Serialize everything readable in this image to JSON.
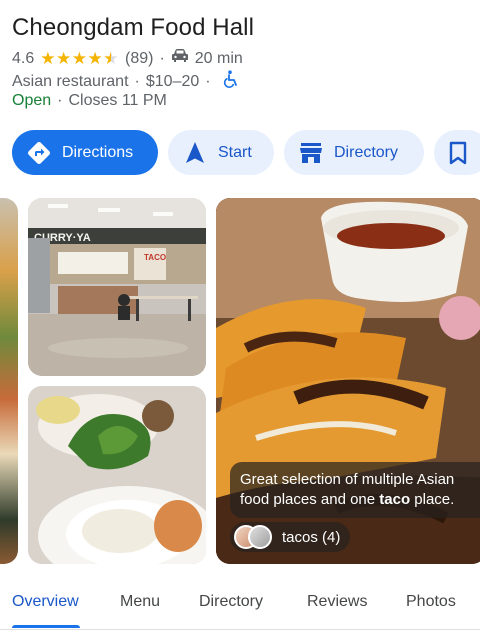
{
  "place": {
    "name": "Cheongdam Food Hall",
    "rating": "4.6",
    "rating_value": 4.6,
    "review_count": "(89)",
    "drive_time": "20 min",
    "category": "Asian restaurant",
    "price": "$10–20",
    "status": "Open",
    "hours": "Closes 11 PM"
  },
  "actions": {
    "directions": "Directions",
    "start": "Start",
    "directory": "Directory"
  },
  "review": {
    "line1": "Great selection of multiple Asian",
    "line2_pre": "food places and one ",
    "line2_bold": "taco",
    "line2_post": " place.",
    "chip_label": "tacos (4)"
  },
  "photo_text": {
    "sign": "CURRY·YA",
    "shop_sign": "TACO"
  },
  "tabs": [
    "Overview",
    "Menu",
    "Directory",
    "Reviews",
    "Photos"
  ],
  "active_tab": "Overview",
  "icons": {
    "rating": "star-icon",
    "drive": "car-icon",
    "accessibility": "wheelchair-icon",
    "directions": "directions-icon",
    "start": "navigation-arrow-icon",
    "directory": "storefront-icon",
    "save": "bookmark-icon"
  },
  "colors": {
    "accent": "#1a73e8",
    "open": "#188038",
    "star": "#f4b400",
    "tonal": "#e8f0fe"
  }
}
